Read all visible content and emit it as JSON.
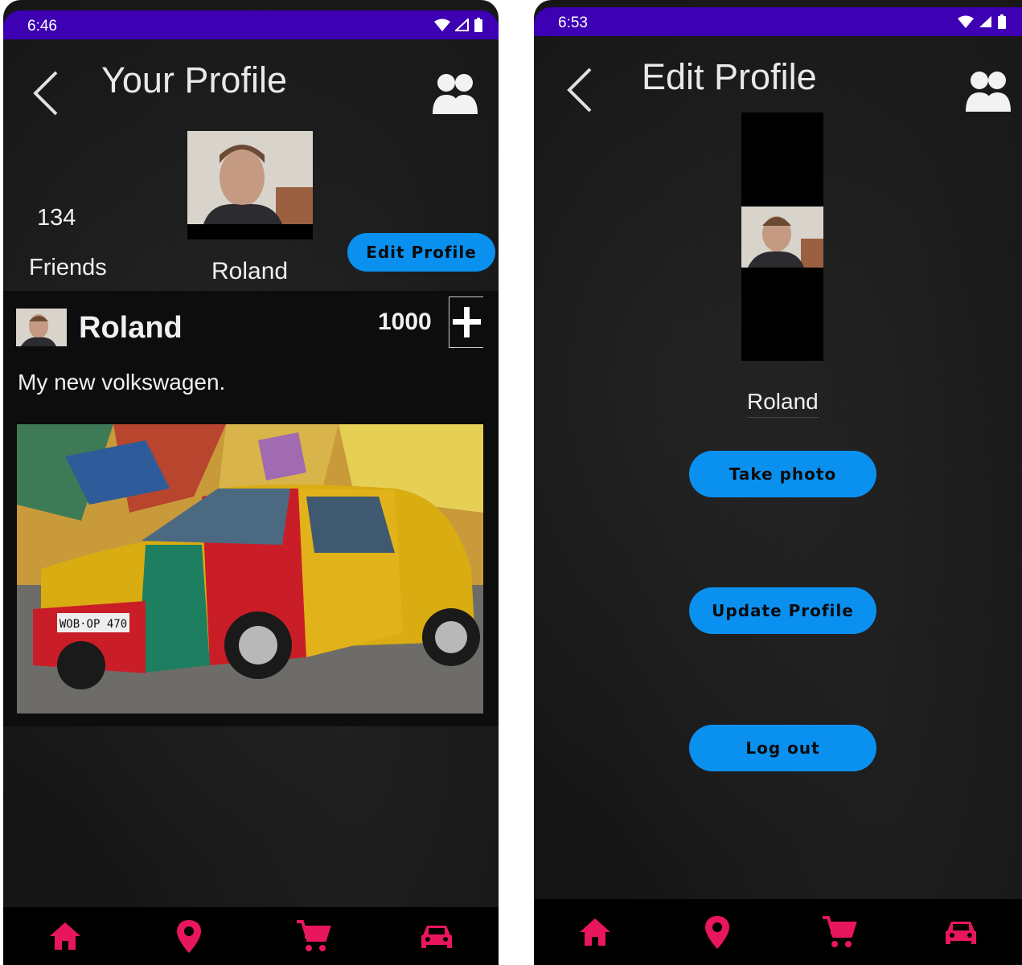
{
  "left": {
    "status_time": "6:46",
    "title": "Your Profile",
    "friends_count": "134",
    "friends_label": "Friends",
    "profile_name": "Roland",
    "edit_profile_label": "Edit Profile",
    "post": {
      "author": "Roland",
      "likes": "1000",
      "caption": "My new volkswagen.",
      "image_plate": "WOB·OP 470"
    }
  },
  "right": {
    "status_time": "6:53",
    "title": "Edit Profile",
    "profile_name": "Roland",
    "take_photo_label": "Take photo",
    "update_profile_label": "Update Profile",
    "logout_label": "Log out"
  },
  "nav": {
    "icons": [
      "home-icon",
      "location-pin-icon",
      "cart-icon",
      "car-icon"
    ],
    "color": "#e8175d"
  },
  "colors": {
    "status_bar": "#3d00b3",
    "button": "#0a91f0"
  }
}
